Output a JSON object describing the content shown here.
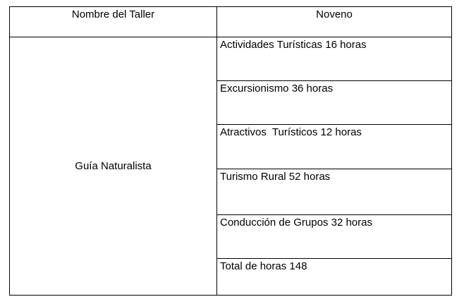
{
  "table": {
    "headers": [
      "Nombre del Taller",
      "Noveno"
    ],
    "workshop_name": "Guía Naturalista",
    "subjects": [
      "Actividades Turísticas 16 horas",
      "Excursionismo 36 horas",
      "Atractivos  Turísticos 12 horas",
      "Turismo Rural 52 horas",
      "Conducción de Grupos 32 horas",
      "Total de horas 148"
    ]
  }
}
